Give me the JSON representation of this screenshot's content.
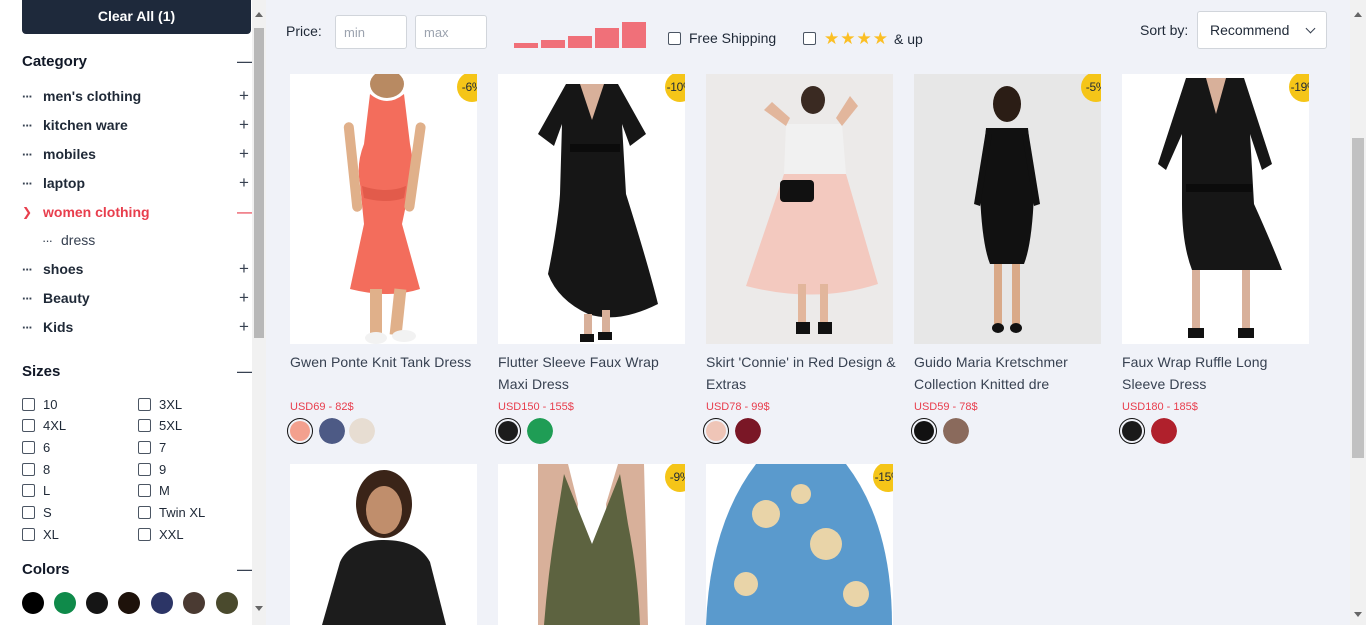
{
  "filters": {
    "clear_all_label": "Clear All (1)",
    "category": {
      "title": "Category",
      "items": [
        {
          "label": "men's clothing"
        },
        {
          "label": "kitchen ware"
        },
        {
          "label": "mobiles"
        },
        {
          "label": "laptop"
        },
        {
          "label": "women clothing",
          "active": true
        },
        {
          "label": "dress",
          "sub": true
        },
        {
          "label": "shoes"
        },
        {
          "label": "Beauty"
        },
        {
          "label": "Kids"
        }
      ]
    },
    "sizes": {
      "title": "Sizes",
      "options": [
        "10",
        "3XL",
        "4XL",
        "5XL",
        "6",
        "7",
        "8",
        "9",
        "L",
        "M",
        "S",
        "Twin XL",
        "XL",
        "XXL"
      ]
    },
    "colors": {
      "title": "Colors",
      "swatches": [
        "#000000",
        "#0f8a4a",
        "#151515",
        "#1e120b",
        "#2c3566",
        "#4a3a32",
        "#4a4a2d"
      ]
    }
  },
  "toolbar": {
    "price_label": "Price:",
    "min_placeholder": "min",
    "max_placeholder": "max",
    "price_histogram": [
      0.2,
      0.3,
      0.45,
      0.75,
      1.0
    ],
    "free_shipping_label": "Free Shipping",
    "rating_stars": 4,
    "rating_suffix": "& up",
    "sort_label": "Sort by:",
    "sort_value": "Recommend"
  },
  "products": [
    {
      "name": "Gwen Ponte Knit Tank Dress",
      "price": "USD69 - 82$",
      "discount": "-6%"
    },
    {
      "name": "Flutter Sleeve Faux Wrap Maxi Dress",
      "price": "USD150 - 155$",
      "discount": "-10%"
    },
    {
      "name": "Skirt 'Connie' in Red Design & Extras",
      "price": "USD78 - 99$",
      "discount": ""
    },
    {
      "name": "Guido Maria Kretschmer Collection Knitted dre",
      "price": "USD59 - 78$",
      "discount": "-5%"
    },
    {
      "name": "Faux Wrap Ruffle Long Sleeve Dress",
      "price": "USD180 - 185$",
      "discount": "-19%"
    },
    {
      "name": "",
      "price": "",
      "discount": ""
    },
    {
      "name": "",
      "price": "",
      "discount": "-9%"
    },
    {
      "name": "",
      "price": "",
      "discount": "-15%"
    }
  ]
}
